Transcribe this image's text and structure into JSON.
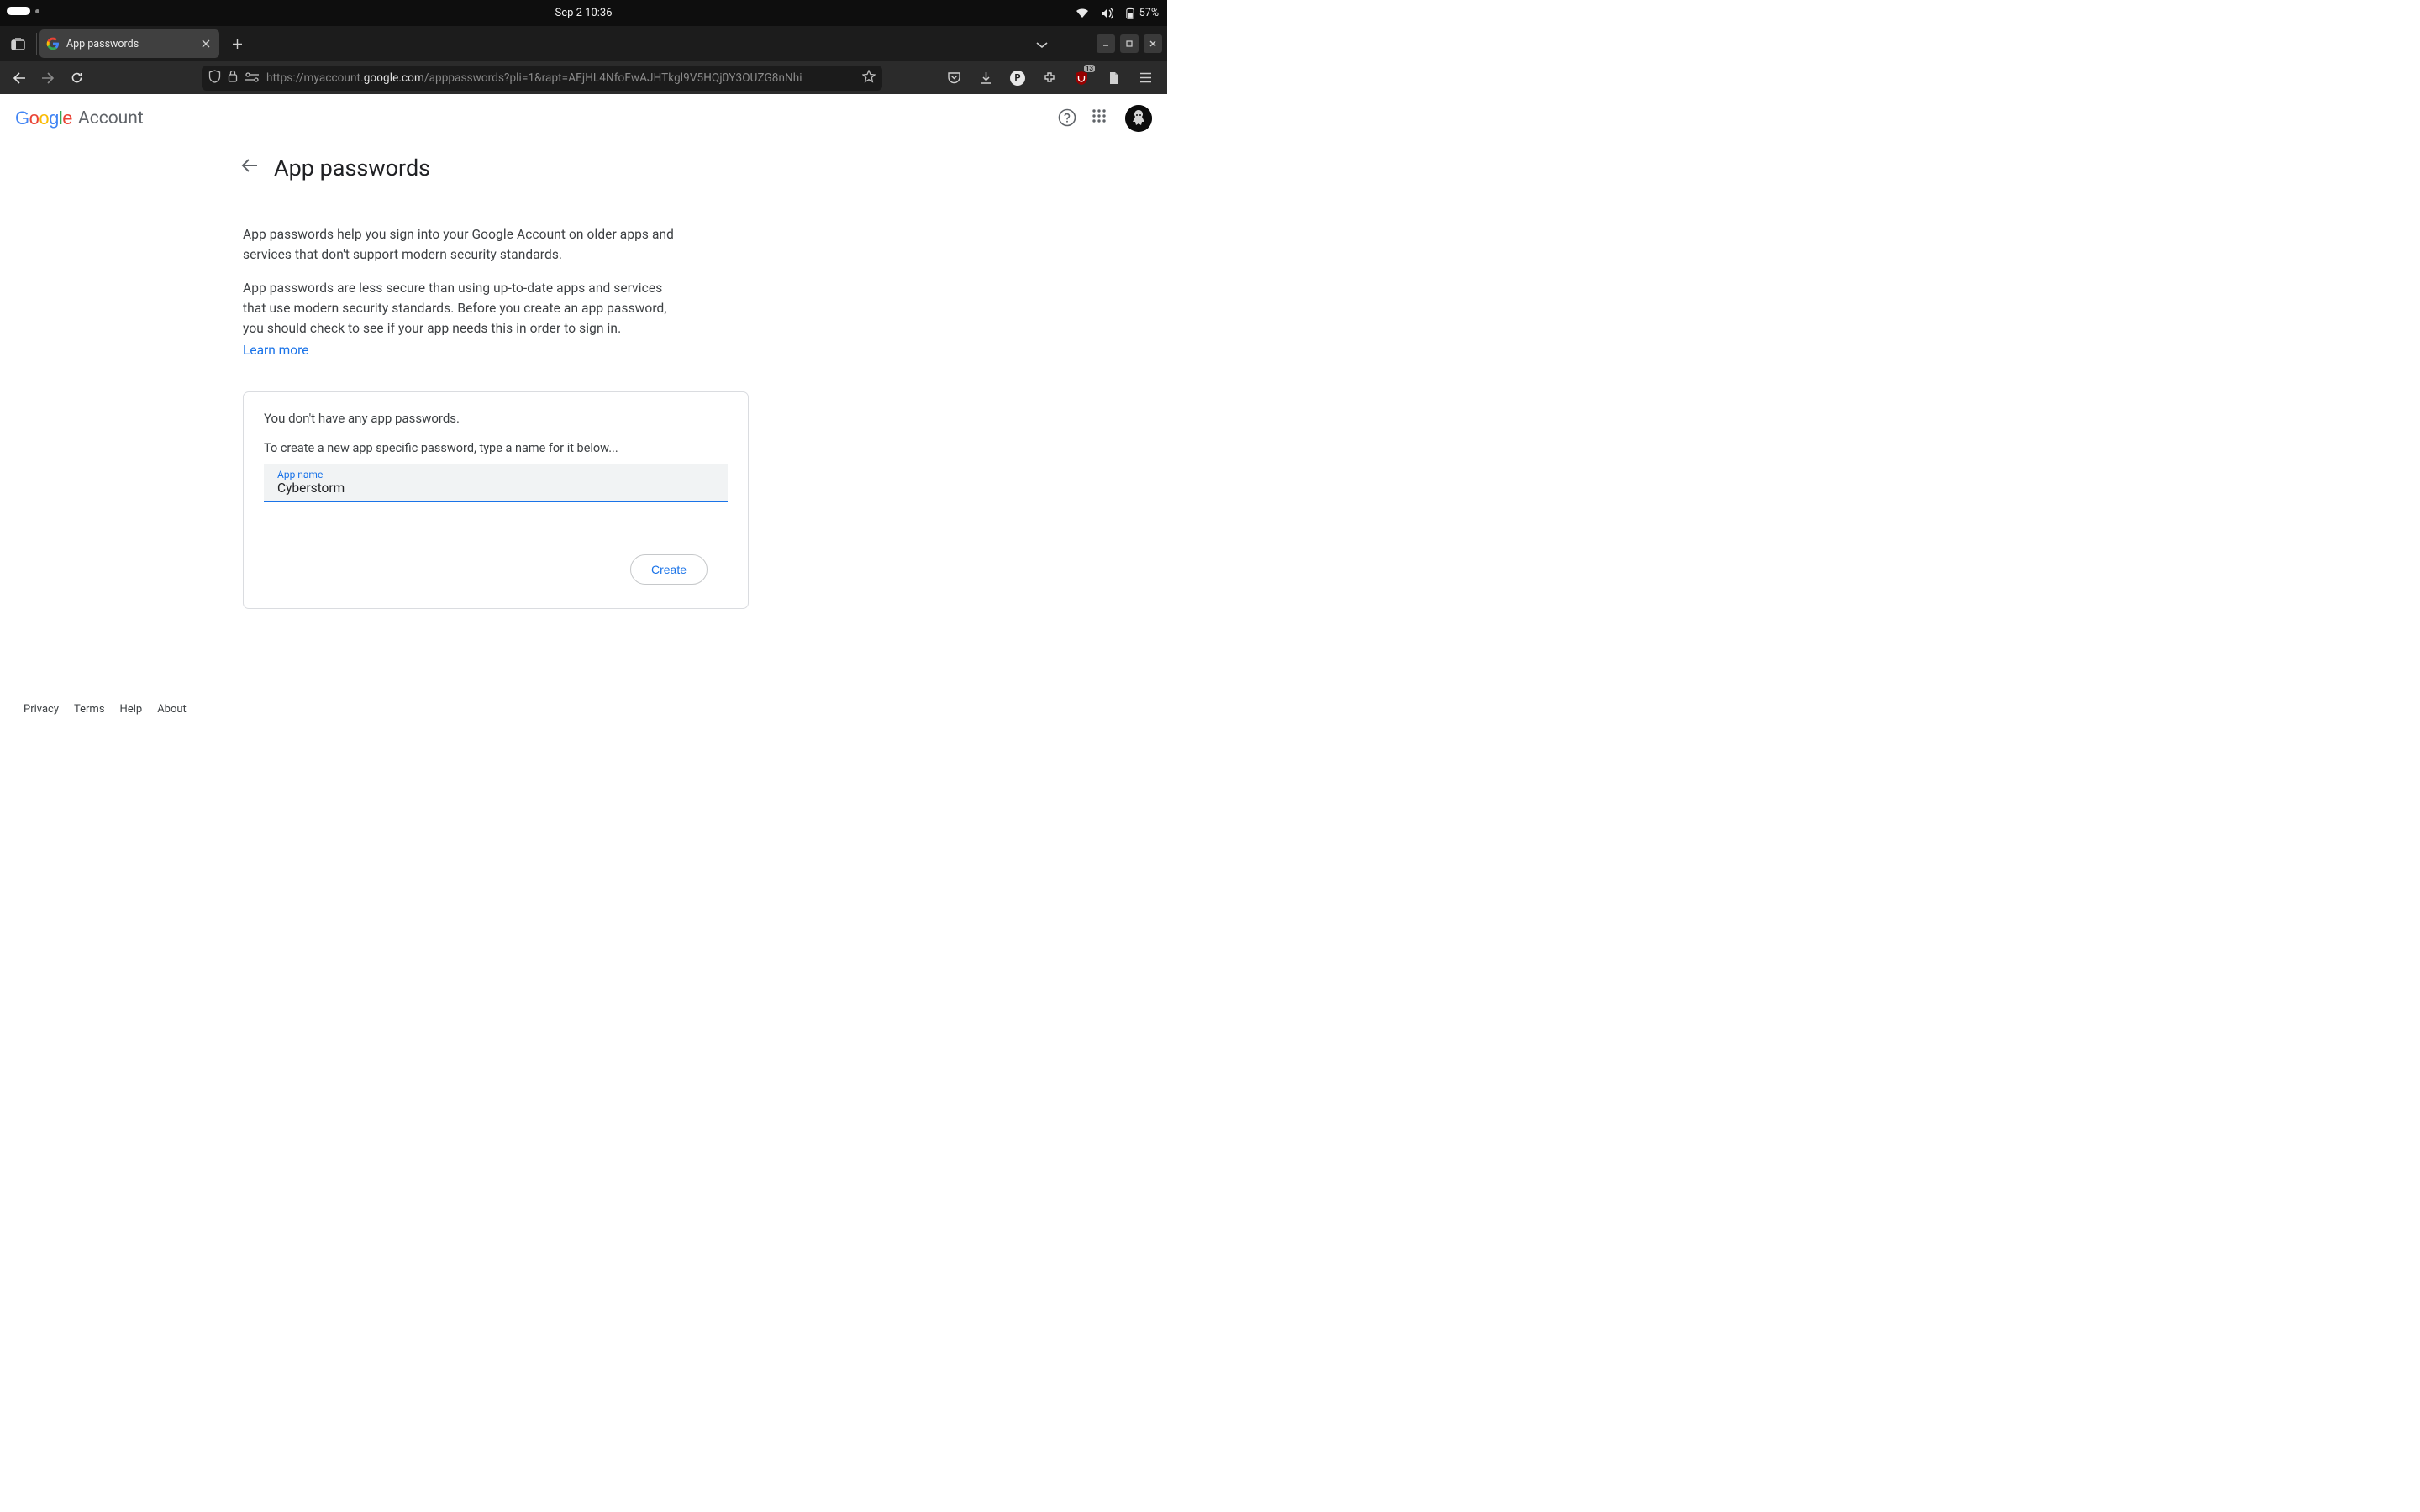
{
  "os_bar": {
    "datetime": "Sep 2  10:36",
    "battery": "57%"
  },
  "browser": {
    "tab_title": "App passwords",
    "url_prefix": "https://myaccount.",
    "url_highlight": "google.com",
    "url_suffix": "/apppasswords?pli=1&rapt=AEjHL4NfoFwAJHTkgl9V5HQj0Y3OUZG8nNhi",
    "ext_badge": "13"
  },
  "header": {
    "google_letters": [
      "G",
      "o",
      "o",
      "g",
      "l",
      "e"
    ],
    "account_text": "Account"
  },
  "page": {
    "title": "App passwords",
    "para1": "App passwords help you sign into your Google Account on older apps and services that don't support modern security standards.",
    "para2": "App passwords are less secure than using up-to-date apps and services that use modern security standards. Before you create an app password, you should check to see if your app needs this in order to sign in.",
    "learn_more": "Learn more"
  },
  "card": {
    "empty_msg": "You don't have any app passwords.",
    "instruction": "To create a new app specific password, type a name for it below...",
    "field_label": "App name",
    "field_value": "Cyberstorm",
    "create_label": "Create"
  },
  "footer": {
    "privacy": "Privacy",
    "terms": "Terms",
    "help": "Help",
    "about": "About"
  }
}
